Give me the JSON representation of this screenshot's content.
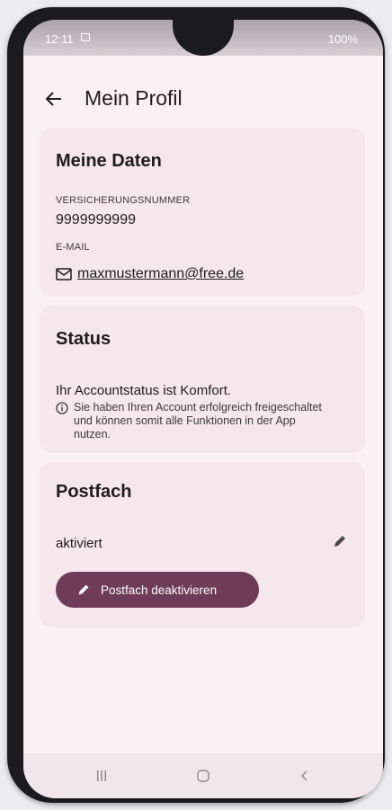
{
  "status_bar": {
    "time": "12:11",
    "right_text": "100%"
  },
  "app_bar": {
    "title": "Mein Profil",
    "back_icon": "arrow-back-icon"
  },
  "card_data": {
    "title": "Meine Daten",
    "insurance_label": "VERSICHERUNGSNUMMER",
    "insurance_value": "9999999999",
    "email_label": "E-MAIL",
    "email_value": "maxmustermann@free.de"
  },
  "card_status": {
    "title": "Status",
    "main_text": "Ihr Accountstatus ist Komfort.",
    "info_text": "Sie haben Ihren Account erfolgreich freigeschaltet und können somit alle Funktionen in der App nutzen."
  },
  "card_postfach": {
    "title": "Postfach",
    "status_text": "aktiviert",
    "button_label": "Postfach deaktivieren"
  },
  "colors": {
    "accent": "#6e3b58",
    "card_bg": "#f6e7ec",
    "page_bg": "#fbf1f3"
  }
}
